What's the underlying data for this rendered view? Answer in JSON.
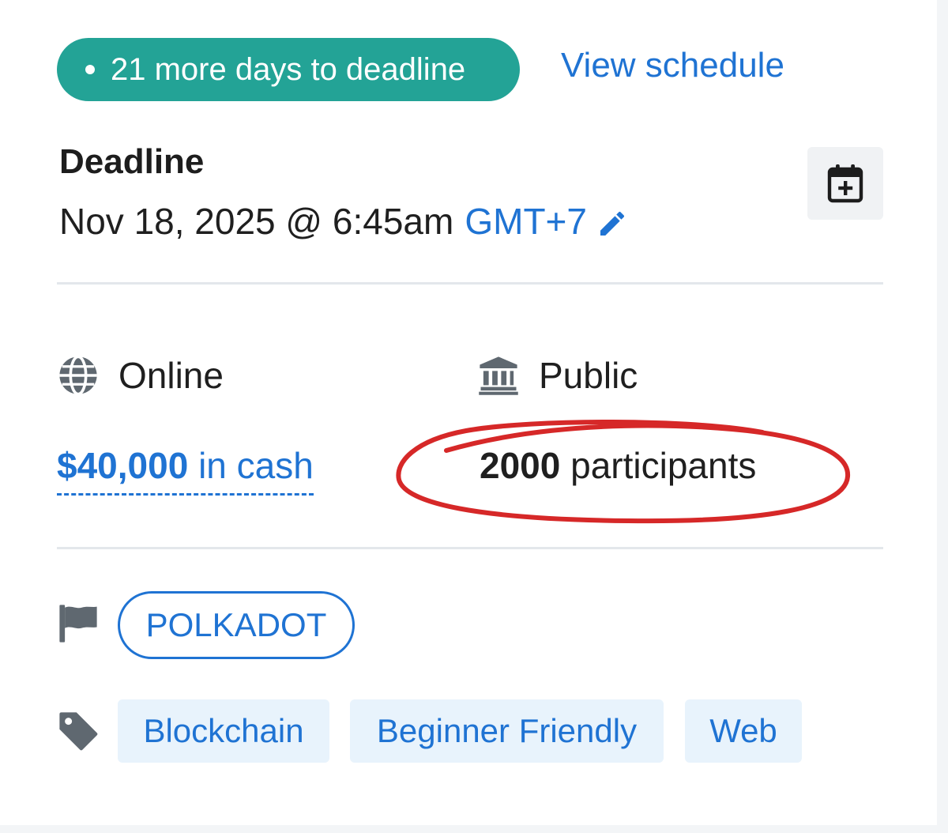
{
  "status_badge": {
    "text": "21 more days to deadline"
  },
  "schedule_link": {
    "label": "View schedule"
  },
  "deadline": {
    "heading": "Deadline",
    "datetime": "Nov 18, 2025 @ 6:45am",
    "timezone": "GMT+7"
  },
  "details": {
    "location": "Online",
    "visibility": "Public",
    "prize_amount": "$40,000",
    "prize_suffix": "in cash",
    "participants_count": "2000",
    "participants_suffix": "participants"
  },
  "host_tag": {
    "label": "POLKADOT"
  },
  "theme_tags": [
    "Blockchain",
    "Beginner Friendly",
    "Web"
  ],
  "icons": {
    "calendar": "calendar-plus-icon",
    "edit": "pencil-icon",
    "location": "globe-icon",
    "visibility": "landmark-icon",
    "host": "flag-icon",
    "themes": "tag-icon"
  },
  "colors": {
    "badge_bg": "#23a396",
    "link": "#1f73d3",
    "tag_bg": "#e8f3fc",
    "icon_gray": "#5f6870",
    "annotation": "#d62828"
  }
}
